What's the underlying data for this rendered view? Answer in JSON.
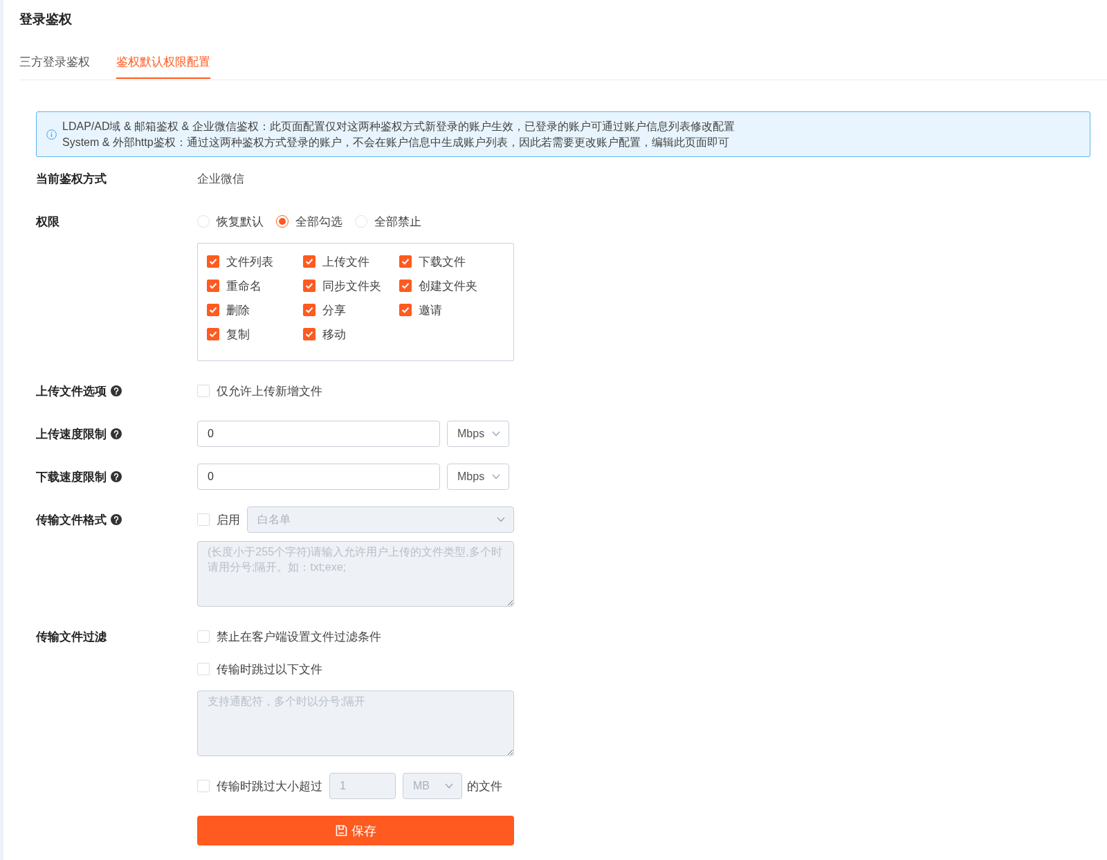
{
  "page_title": "登录鉴权",
  "tabs": [
    {
      "label": "三方登录鉴权",
      "selected": false
    },
    {
      "label": "鉴权默认权限配置",
      "selected": true
    }
  ],
  "notice": {
    "lines": [
      "LDAP/AD域 & 邮箱鉴权 & 企业微信鉴权：此页面配置仅对这两种鉴权方式新登录的账户生效，已登录的账户可通过账户信息列表修改配置",
      "System & 外部http鉴权：通过这两种鉴权方式登录的账户，不会在账户信息中生成账户列表，因此若需要更改账户配置，编辑此页面即可"
    ]
  },
  "fields": [
    {
      "kind": "text",
      "label": "当前鉴权方式",
      "value": "企业微信"
    },
    {
      "kind": "permissions",
      "label": "权限",
      "options": [
        {
          "label": "恢复默认",
          "selected": false
        },
        {
          "label": "全部勾选",
          "selected": true
        },
        {
          "label": "全部禁止",
          "selected": false
        }
      ],
      "permissions": [
        {
          "label": "文件列表",
          "checked": true
        },
        {
          "label": "上传文件",
          "checked": true
        },
        {
          "label": "下载文件",
          "checked": true
        },
        {
          "label": "重命名",
          "checked": true
        },
        {
          "label": "同步文件夹",
          "checked": true
        },
        {
          "label": "创建文件夹",
          "checked": true
        },
        {
          "label": "删除",
          "checked": true
        },
        {
          "label": "分享",
          "checked": true
        },
        {
          "label": "邀请",
          "checked": true
        },
        {
          "label": "复制",
          "checked": true
        },
        {
          "label": "移动",
          "checked": true
        }
      ]
    },
    {
      "kind": "checkbox",
      "label": "上传文件选项",
      "help": true,
      "checkbox": {
        "label": "仅允许上传新增文件",
        "checked": false
      }
    },
    {
      "kind": "speed",
      "label": "上传速度限制",
      "help": true,
      "value": "0",
      "unit": "Mbps"
    },
    {
      "kind": "speed",
      "label": "下载速度限制",
      "help": true,
      "value": "0",
      "unit": "Mbps"
    },
    {
      "kind": "format",
      "label": "传输文件格式",
      "help": true,
      "enable": {
        "label": "启用",
        "checked": false
      },
      "list_type": {
        "value": "白名单",
        "disabled": true
      },
      "textarea": {
        "placeholder": "(长度小于255个字符)请输入允许用户上传的文件类型,多个时请用分号;隔开。如：txt;exe;",
        "disabled": true
      }
    },
    {
      "kind": "filter",
      "label": "传输文件过滤",
      "block_client": {
        "label": "禁止在客户端设置文件过滤条件",
        "checked": false
      },
      "skip_files": {
        "label": "传输时跳过以下文件",
        "checked": false
      },
      "textarea": {
        "placeholder": "支持通配符，多个时以分号;隔开",
        "disabled": true
      },
      "skip_size": {
        "label": "传输时跳过大小超过",
        "checked": false,
        "value": "1",
        "unit": "MB",
        "disabled": true,
        "suffix": "的文件"
      }
    }
  ],
  "save_button": "保存"
}
